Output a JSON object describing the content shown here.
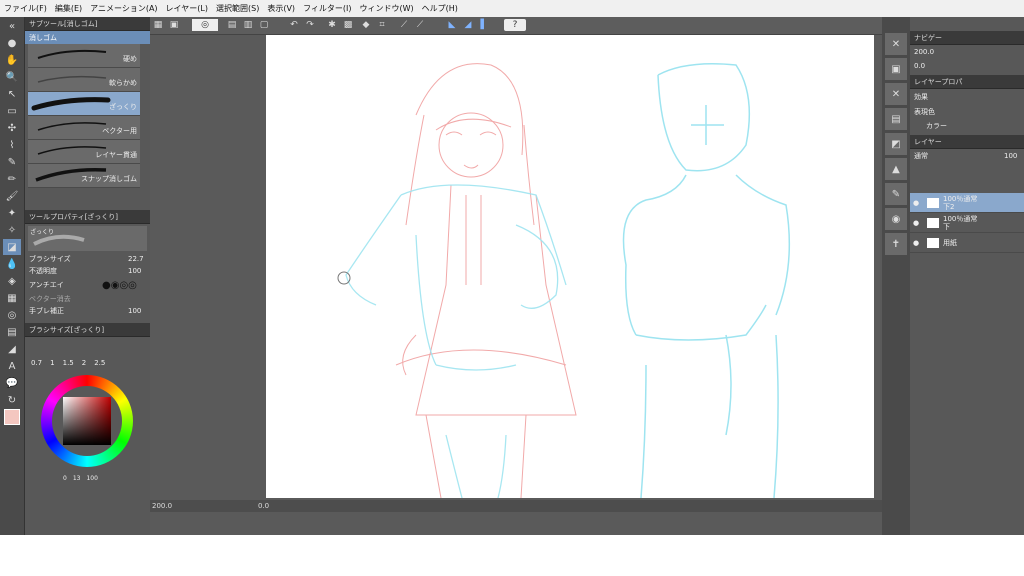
{
  "menu": [
    "ファイル(F)",
    "編集(E)",
    "アニメーション(A)",
    "レイヤー(L)",
    "選択範囲(S)",
    "表示(V)",
    "フィルター(I)",
    "ウィンドウ(W)",
    "ヘルプ(H)"
  ],
  "subtool": {
    "title": "サブツール[消しゴム]",
    "tab": "消しゴム",
    "brushes": [
      "硬め",
      "軟らかめ",
      "ざっくり",
      "ベクター用",
      "レイヤー貫通",
      "スナップ消しゴム"
    ],
    "selected_index": 2
  },
  "toolprop": {
    "title": "ツールプロパティ[ざっくり]",
    "preset": "ざっくり",
    "brush_size_label": "ブラシサイズ",
    "brush_size_value": "22.7",
    "opacity_label": "不透明度",
    "opacity_value": "100",
    "antialias_label": "アンチエイ",
    "vector_erase_label": "ベクター消去",
    "stabilization_label": "手ブレ補正",
    "stabilization_value": "100"
  },
  "brushsize": {
    "title": "ブラシサイズ[ざっくり]",
    "sizes": [
      "0.7",
      "1",
      "1.5",
      "2",
      "2.5"
    ]
  },
  "color": {
    "main": "#f4c7c0",
    "sub": "#f9d9d2",
    "hue_square": "#c00000",
    "footer_values": [
      "0",
      "13",
      "100"
    ]
  },
  "statusbar": {
    "zoom": "200.0",
    "angle": "0.0"
  },
  "navigator": {
    "title": "ナビゲー",
    "zoom": "200.0",
    "angle": "0.0"
  },
  "layerprop": {
    "title": "レイヤープロパ",
    "effect_label": "効果",
    "expression_color_label": "表現色",
    "color_mode": "カラー"
  },
  "layers": {
    "title": "レイヤー",
    "blend_mode": "通常",
    "opacity": "100",
    "items": [
      {
        "blend": "100％通常",
        "name": "下2"
      },
      {
        "blend": "100％通常",
        "name": "下"
      },
      {
        "blend": "",
        "name": "用紙"
      }
    ]
  }
}
